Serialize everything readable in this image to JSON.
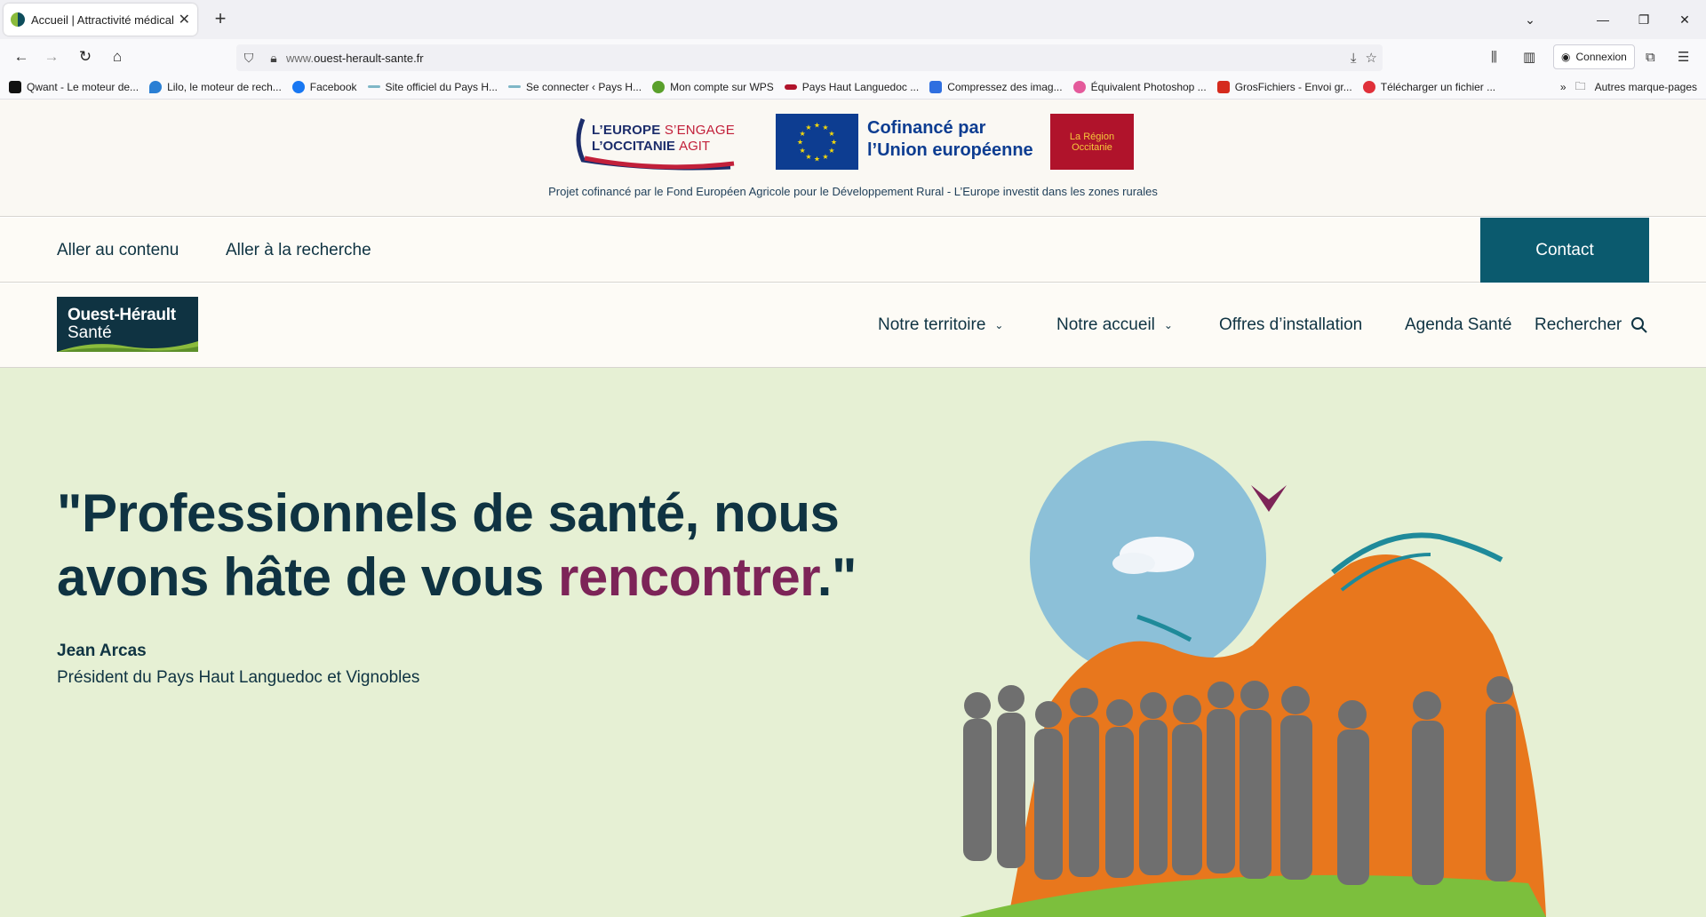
{
  "browser": {
    "tab_title": "Accueil | Attractivité médicale",
    "tab_close": "✕",
    "new_tab": "+",
    "url_prefix": "www.",
    "url_domain": "ouest-herault-sante.fr",
    "account_label": "Connexion"
  },
  "bookmarks": [
    {
      "label": "Qwant - Le moteur de...",
      "color": "#111111"
    },
    {
      "label": "Lilo, le moteur de rech...",
      "color": "#2a7fd4"
    },
    {
      "label": "Facebook",
      "color": "#1877f2"
    },
    {
      "label": "Site officiel du Pays H...",
      "color": "#7fb7c7"
    },
    {
      "label": "Se connecter ‹ Pays H...",
      "color": "#7fb7c7"
    },
    {
      "label": "Mon compte sur WPS",
      "color": "#5aa02c"
    },
    {
      "label": "Pays Haut Languedoc ...",
      "color": "#b0132b"
    },
    {
      "label": "Compressez des imag...",
      "color": "#2f6fe0"
    },
    {
      "label": "Équivalent Photoshop ...",
      "color": "#e45a9b"
    },
    {
      "label": "GrosFichiers - Envoi gr...",
      "color": "#d52b1e"
    },
    {
      "label": "Télécharger un fichier ...",
      "color": "#e0303a"
    }
  ],
  "bookmarks_other": "Autres marque-pages",
  "funding": {
    "europe_logo_line1_a": "L’EUROPE ",
    "europe_logo_line1_b": "S’ENGAGE",
    "europe_logo_line2_a": "L’OCCITANIE ",
    "europe_logo_line2_b": "AGIT",
    "eu_text_line1": "Cofinancé par",
    "eu_text_line2": "l’Union européenne",
    "region_logo": "La Région Occitanie",
    "caption": "Projet cofinancé par le Fond Européen Agricole pour le Développement Rural - L’Europe investit dans les zones rurales"
  },
  "skip_links": {
    "content": "Aller au contenu",
    "search": "Aller à la recherche",
    "contact": "Contact"
  },
  "site": {
    "logo_line1": "Ouest-Hérault",
    "logo_line2": "Santé"
  },
  "nav": {
    "territoire": "Notre territoire",
    "accueil": "Notre accueil",
    "offres": "Offres d’installation",
    "agenda": "Agenda Santé",
    "rechercher": "Rechercher"
  },
  "hero": {
    "quote_part1": "\"Professionnels de santé, nous avons hâte de vous ",
    "quote_highlight": "rencontrer",
    "quote_part2": ".\"",
    "author_name": "Jean Arcas",
    "author_role": "Président du Pays Haut Languedoc et Vignobles"
  },
  "colors": {
    "brand_dark": "#0f3342",
    "contact_bg": "#0b5a6e",
    "hero_bg": "#e6f0d4",
    "highlight": "#7d2458",
    "orange": "#e8771d",
    "sky": "#8cc0d8"
  }
}
